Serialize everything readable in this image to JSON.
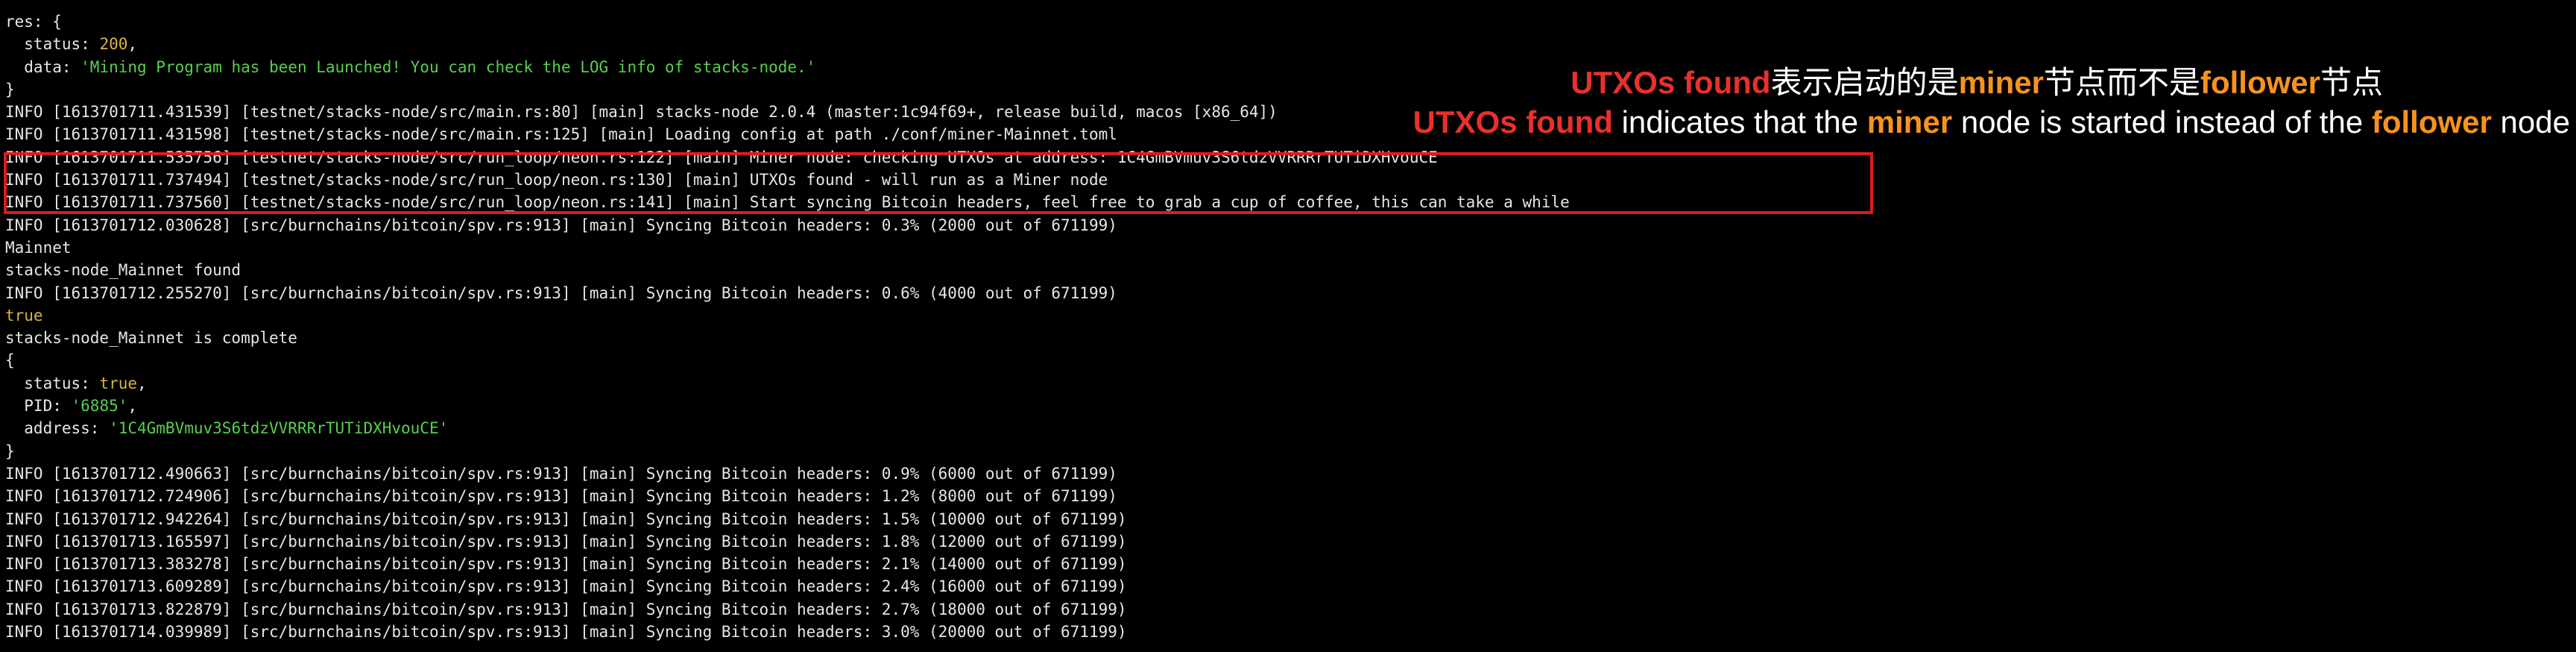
{
  "terminal": {
    "lines": [
      [
        {
          "t": "res: {"
        }
      ],
      [
        {
          "t": "  status: "
        },
        {
          "t": "200",
          "c": "num"
        },
        {
          "t": ","
        }
      ],
      [
        {
          "t": "  data: "
        },
        {
          "t": "'Mining Program has been Launched! You can check the LOG info of stacks-node.'",
          "c": "str"
        }
      ],
      [
        {
          "t": "}"
        }
      ],
      [
        {
          "t": "INFO [1613701711.431539] [testnet/stacks-node/src/main.rs:80] [main] stacks-node 2.0.4 (master:1c94f69+, release build, macos [x86_64])"
        }
      ],
      [
        {
          "t": "INFO [1613701711.431598] [testnet/stacks-node/src/main.rs:125] [main] Loading config at path ./conf/miner-Mainnet.toml"
        }
      ],
      [
        {
          "t": "INFO [1613701711.535756] [testnet/stacks-node/src/run_loop/neon.rs:122] [main] Miner node: checking UTXOs at address: 1C4GmBVmuv3S6tdzVVRRRrTUTiDXHvouCE"
        }
      ],
      [
        {
          "t": "INFO [1613701711.737494] [testnet/stacks-node/src/run_loop/neon.rs:130] [main] UTXOs found - will run as a Miner node"
        }
      ],
      [
        {
          "t": "INFO [1613701711.737560] [testnet/stacks-node/src/run_loop/neon.rs:141] [main] Start syncing Bitcoin headers, feel free to grab a cup of coffee, this can take a while"
        }
      ],
      [
        {
          "t": "INFO [1613701712.030628] [src/burnchains/bitcoin/spv.rs:913] [main] Syncing Bitcoin headers: 0.3% (2000 out of 671199)"
        }
      ],
      [
        {
          "t": "Mainnet"
        }
      ],
      [
        {
          "t": "stacks-node_Mainnet found"
        }
      ],
      [
        {
          "t": "INFO [1613701712.255270] [src/burnchains/bitcoin/spv.rs:913] [main] Syncing Bitcoin headers: 0.6% (4000 out of 671199)"
        }
      ],
      [
        {
          "t": "true",
          "c": "bool"
        }
      ],
      [
        {
          "t": "stacks-node_Mainnet is complete"
        }
      ],
      [
        {
          "t": "{"
        }
      ],
      [
        {
          "t": "  status: "
        },
        {
          "t": "true",
          "c": "bool"
        },
        {
          "t": ","
        }
      ],
      [
        {
          "t": "  PID: "
        },
        {
          "t": "'6885'",
          "c": "str"
        },
        {
          "t": ","
        }
      ],
      [
        {
          "t": "  address: "
        },
        {
          "t": "'1C4GmBVmuv3S6tdzVVRRRrTUTiDXHvouCE'",
          "c": "str"
        }
      ],
      [
        {
          "t": "}"
        }
      ],
      [
        {
          "t": "INFO [1613701712.490663] [src/burnchains/bitcoin/spv.rs:913] [main] Syncing Bitcoin headers: 0.9% (6000 out of 671199)"
        }
      ],
      [
        {
          "t": "INFO [1613701712.724906] [src/burnchains/bitcoin/spv.rs:913] [main] Syncing Bitcoin headers: 1.2% (8000 out of 671199)"
        }
      ],
      [
        {
          "t": "INFO [1613701712.942264] [src/burnchains/bitcoin/spv.rs:913] [main] Syncing Bitcoin headers: 1.5% (10000 out of 671199)"
        }
      ],
      [
        {
          "t": "INFO [1613701713.165597] [src/burnchains/bitcoin/spv.rs:913] [main] Syncing Bitcoin headers: 1.8% (12000 out of 671199)"
        }
      ],
      [
        {
          "t": "INFO [1613701713.383278] [src/burnchains/bitcoin/spv.rs:913] [main] Syncing Bitcoin headers: 2.1% (14000 out of 671199)"
        }
      ],
      [
        {
          "t": "INFO [1613701713.609289] [src/burnchains/bitcoin/spv.rs:913] [main] Syncing Bitcoin headers: 2.4% (16000 out of 671199)"
        }
      ],
      [
        {
          "t": "INFO [1613701713.822879] [src/burnchains/bitcoin/spv.rs:913] [main] Syncing Bitcoin headers: 2.7% (18000 out of 671199)"
        }
      ],
      [
        {
          "t": "INFO [1613701714.039989] [src/burnchains/bitcoin/spv.rs:913] [main] Syncing Bitcoin headers: 3.0% (20000 out of 671199)"
        }
      ]
    ]
  },
  "annotation_zh": {
    "part1": "UTXOs found",
    "part2": "表示启动的是",
    "part3": "miner",
    "part4": "节点而不是",
    "part5": "follower",
    "part6": "节点"
  },
  "annotation_en": {
    "part1": "UTXOs found",
    "part2": " indicates that the ",
    "part3": "miner",
    "part4": " node is started instead of the ",
    "part5": "follower",
    "part6": " node"
  },
  "colors": {
    "background": "#000000",
    "text": "#e6e6e6",
    "string": "#57d14c",
    "number": "#d9b440",
    "annotation_red": "#e8312b",
    "annotation_orange": "#f7931d",
    "highlight_border": "#d81e1e"
  }
}
